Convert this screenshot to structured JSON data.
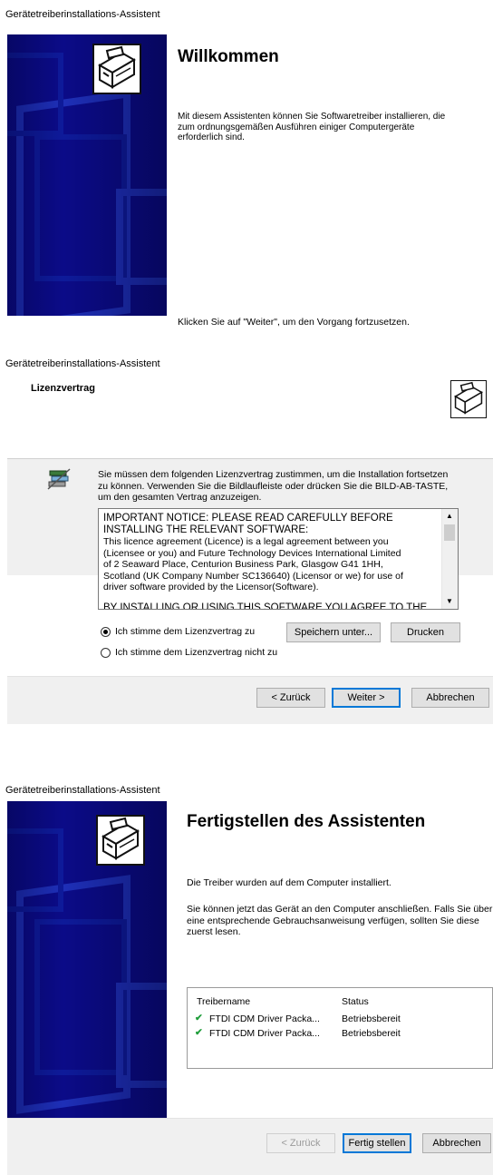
{
  "screen1": {
    "window_title": "Gerätetreiberinstallations-Assistent",
    "heading": "Willkommen",
    "intro": "Mit diesem Assistenten können Sie Softwaretreiber installieren, die zum ordnungsgemäßen Ausführen einiger Computergeräte erforderlich sind.",
    "footer_text": "Klicken Sie auf \"Weiter\", um den Vorgang fortzusetzen.",
    "icon": "hardware-install-icon"
  },
  "screen2": {
    "window_title": "Gerätetreiberinstallations-Assistent",
    "heading": "Lizenzvertrag",
    "instruction": "Sie müssen dem folgenden Lizenzvertrag zustimmen, um die Installation fortsetzen zu können. Verwenden Sie die Bildlaufleiste oder drücken Sie die BILD-AB-TASTE, um den gesamten Vertrag anzuzeigen.",
    "license_lines": [
      "IMPORTANT NOTICE: PLEASE READ CAREFULLY BEFORE",
      "INSTALLING THE RELEVANT SOFTWARE:",
      "This licence agreement (Licence) is a legal agreement between you",
      "(Licensee or you) and Future Technology Devices International Limited",
      "of 2 Seaward Place, Centurion Business Park, Glasgow G41 1HH,",
      "Scotland (UK Company Number SC136640) (Licensor or we) for use of",
      "driver software provided by the Licensor(Software).",
      "",
      "BY INSTALLING OR USING THIS SOFTWARE YOU AGREE TO THE"
    ],
    "radio_accept": "Ich stimme dem Lizenzvertrag zu",
    "radio_decline": "Ich stimme dem Lizenzvertrag nicht zu",
    "save_button": "Speichern unter...",
    "print_button": "Drucken",
    "back_button": "< Zurück",
    "next_button": "Weiter >",
    "cancel_button": "Abbrechen"
  },
  "screen3": {
    "window_title": "Gerätetreiberinstallations-Assistent",
    "heading": "Fertigstellen des Assistenten",
    "installed_text": "Die Treiber wurden auf dem Computer installiert.",
    "connect_text": "Sie können jetzt das Gerät an den Computer anschließen. Falls Sie über eine entsprechende Gebrauchsanweisung verfügen, sollten Sie diese zuerst lesen.",
    "table": {
      "columns": [
        "Treibername",
        "Status"
      ],
      "rows": [
        {
          "name": "FTDI CDM Driver Packa...",
          "status": "Betriebsbereit"
        },
        {
          "name": "FTDI CDM Driver Packa...",
          "status": "Betriebsbereit"
        }
      ]
    },
    "back_button": "< Zurück",
    "finish_button": "Fertig stellen",
    "cancel_button": "Abbrechen"
  },
  "colors": {
    "banner_blue": "#0b0b88",
    "accent": "#0078d7",
    "success_green": "#1f9d3a"
  }
}
